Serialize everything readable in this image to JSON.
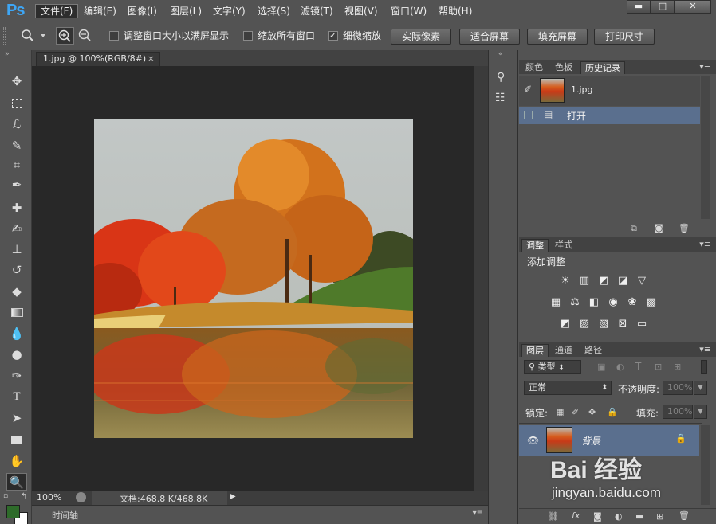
{
  "app": {
    "logo": "Ps"
  },
  "menu": [
    {
      "label": "文件(F)"
    },
    {
      "label": "编辑(E)"
    },
    {
      "label": "图像(I)"
    },
    {
      "label": "图层(L)"
    },
    {
      "label": "文字(Y)"
    },
    {
      "label": "选择(S)"
    },
    {
      "label": "滤镜(T)"
    },
    {
      "label": "视图(V)"
    },
    {
      "label": "窗口(W)"
    },
    {
      "label": "帮助(H)"
    }
  ],
  "window_controls": {
    "minimize": "▬",
    "maximize": "□",
    "close": "✕"
  },
  "options": {
    "resize_windows": "调整窗口大小以满屏显示",
    "zoom_all": "缩放所有窗口",
    "scrubby_zoom": "细微缩放",
    "actual_pixels": "实际像素",
    "fit_screen": "适合屏幕",
    "fill_screen": "填充屏幕",
    "print_size": "打印尺寸",
    "resize_windows_checked": false,
    "zoom_all_checked": false,
    "scrubby_zoom_checked": true
  },
  "document": {
    "tab_title": "1.jpg @ 100%(RGB/8#)",
    "tab_close": "×",
    "zoom": "100%",
    "doc_size": "文档:468.8 K/468.8K",
    "status_arrow": "▶"
  },
  "timeline": {
    "label": "时间轴"
  },
  "history_panel": {
    "tabs": [
      "颜色",
      "色板",
      "历史记录"
    ],
    "active_tab": "历史记录",
    "snapshot_name": "1.jpg",
    "states": [
      "打开"
    ]
  },
  "adjustments_panel": {
    "tabs": [
      "调整",
      "样式"
    ],
    "active_tab": "调整",
    "heading": "添加调整"
  },
  "layers_panel": {
    "tabs": [
      "图层",
      "通道",
      "路径"
    ],
    "active_tab": "图层",
    "filter_kind": "类型",
    "blend_mode": "正常",
    "opacity_label": "不透明度:",
    "opacity_value": "100%",
    "lock_label": "锁定:",
    "fill_label": "填充:",
    "fill_value": "100%",
    "layers": [
      {
        "name": "背景",
        "locked": true,
        "visible": true
      }
    ]
  },
  "watermark": {
    "text": "Bai 经验",
    "url": "jingyan.baidu.com"
  },
  "colors": {
    "foreground": "#2e6b2a",
    "background": "#ffffff",
    "accent_ps": "#3ea6f5",
    "selected_row": "#5a6f8e"
  }
}
